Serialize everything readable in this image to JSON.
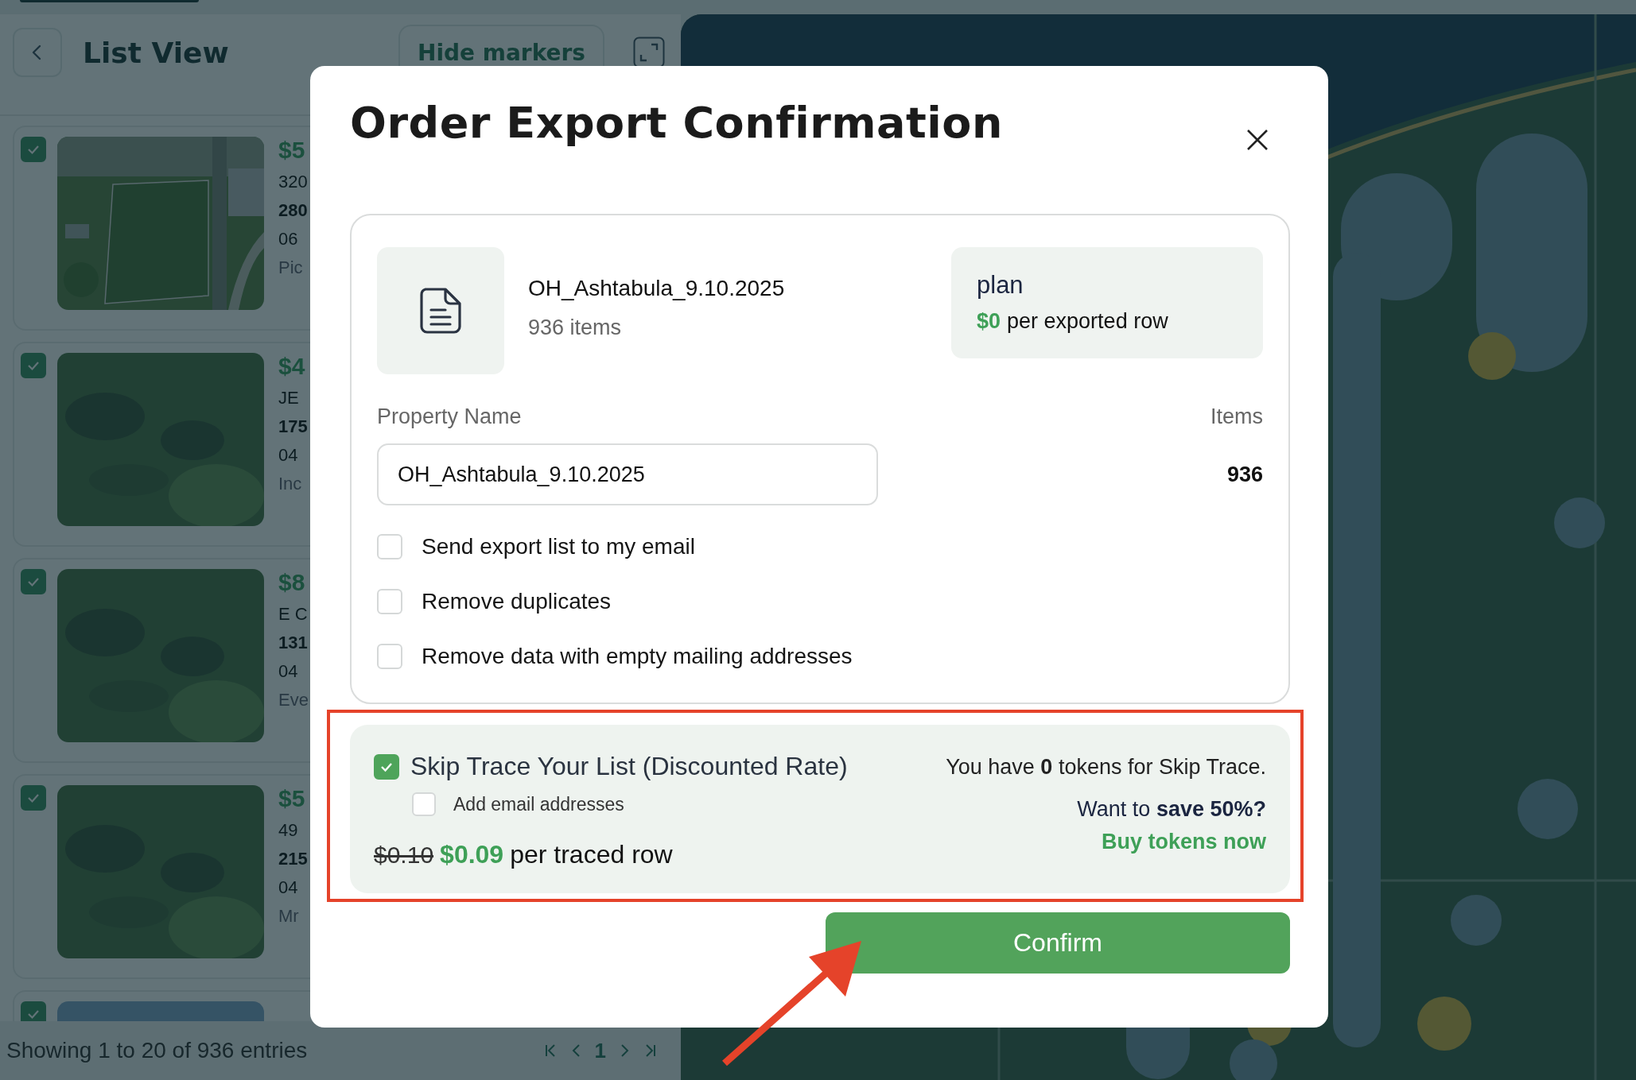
{
  "list_panel": {
    "title": "List View",
    "hide_markers_button": "Hide markers",
    "cards": [
      {
        "checked": true,
        "price": "$5",
        "lines": [
          {
            "text": "320",
            "bold": false
          },
          {
            "text": "280",
            "bold": true
          },
          {
            "text": "06",
            "bold": false
          },
          {
            "text": "Pic",
            "bold": false,
            "muted": true
          }
        ],
        "image": {
          "kind": "picture"
        }
      },
      {
        "checked": true,
        "price": "$4",
        "lines": [
          {
            "text": "JE",
            "bold": false
          },
          {
            "text": "175",
            "bold": true
          },
          {
            "text": "04",
            "bold": false
          },
          {
            "text": "Inc",
            "bold": false,
            "muted": true
          }
        ],
        "image": {
          "kind": "picture"
        }
      },
      {
        "checked": true,
        "price": "$8",
        "lines": [
          {
            "text": "E C",
            "bold": false
          },
          {
            "text": "131",
            "bold": true
          },
          {
            "text": "04",
            "bold": false
          },
          {
            "text": "Eve",
            "bold": false,
            "muted": true
          }
        ],
        "image": {
          "kind": "picture"
        }
      },
      {
        "checked": true,
        "price": "$5",
        "lines": [
          {
            "text": "49",
            "bold": false
          },
          {
            "text": "215",
            "bold": true
          },
          {
            "text": "04",
            "bold": false
          },
          {
            "text": "Mr",
            "bold": false,
            "muted": true
          }
        ],
        "image": {
          "kind": "picture"
        }
      },
      {
        "checked": true,
        "image": {
          "kind": "picture"
        }
      }
    ],
    "footer": {
      "summary": "Showing 1 to 20 of 936 entries",
      "page": "1"
    }
  },
  "map": {
    "kind": "picture"
  },
  "modal": {
    "title": "Order Export Confirmation",
    "file": {
      "name": "OH_Ashtabula_9.10.2025",
      "count": "936 items"
    },
    "plan": {
      "name": "plan",
      "price": "$0",
      "price_suffix": "per exported row"
    },
    "property_label": "Property Name",
    "items_label": "Items",
    "property_value": "OH_Ashtabula_9.10.2025",
    "items_value": "936",
    "options": [
      {
        "label": "Send export list to my email",
        "checked": false
      },
      {
        "label": "Remove duplicates",
        "checked": false
      },
      {
        "label": "Remove data with empty mailing addresses",
        "checked": false
      }
    ],
    "skip_trace": {
      "checked": true,
      "label": "Skip Trace Your List (Discounted Rate)",
      "sub_option": {
        "label": "Add email addresses",
        "checked": false
      },
      "old_price": "$0.10",
      "price": "$0.09",
      "price_suffix": "per traced row",
      "tokens": "You have **0** tokens for Skip Trace.",
      "save": "Want to **save 50%?**",
      "buy_link": "Buy tokens now"
    },
    "confirm_button": "Confirm"
  }
}
